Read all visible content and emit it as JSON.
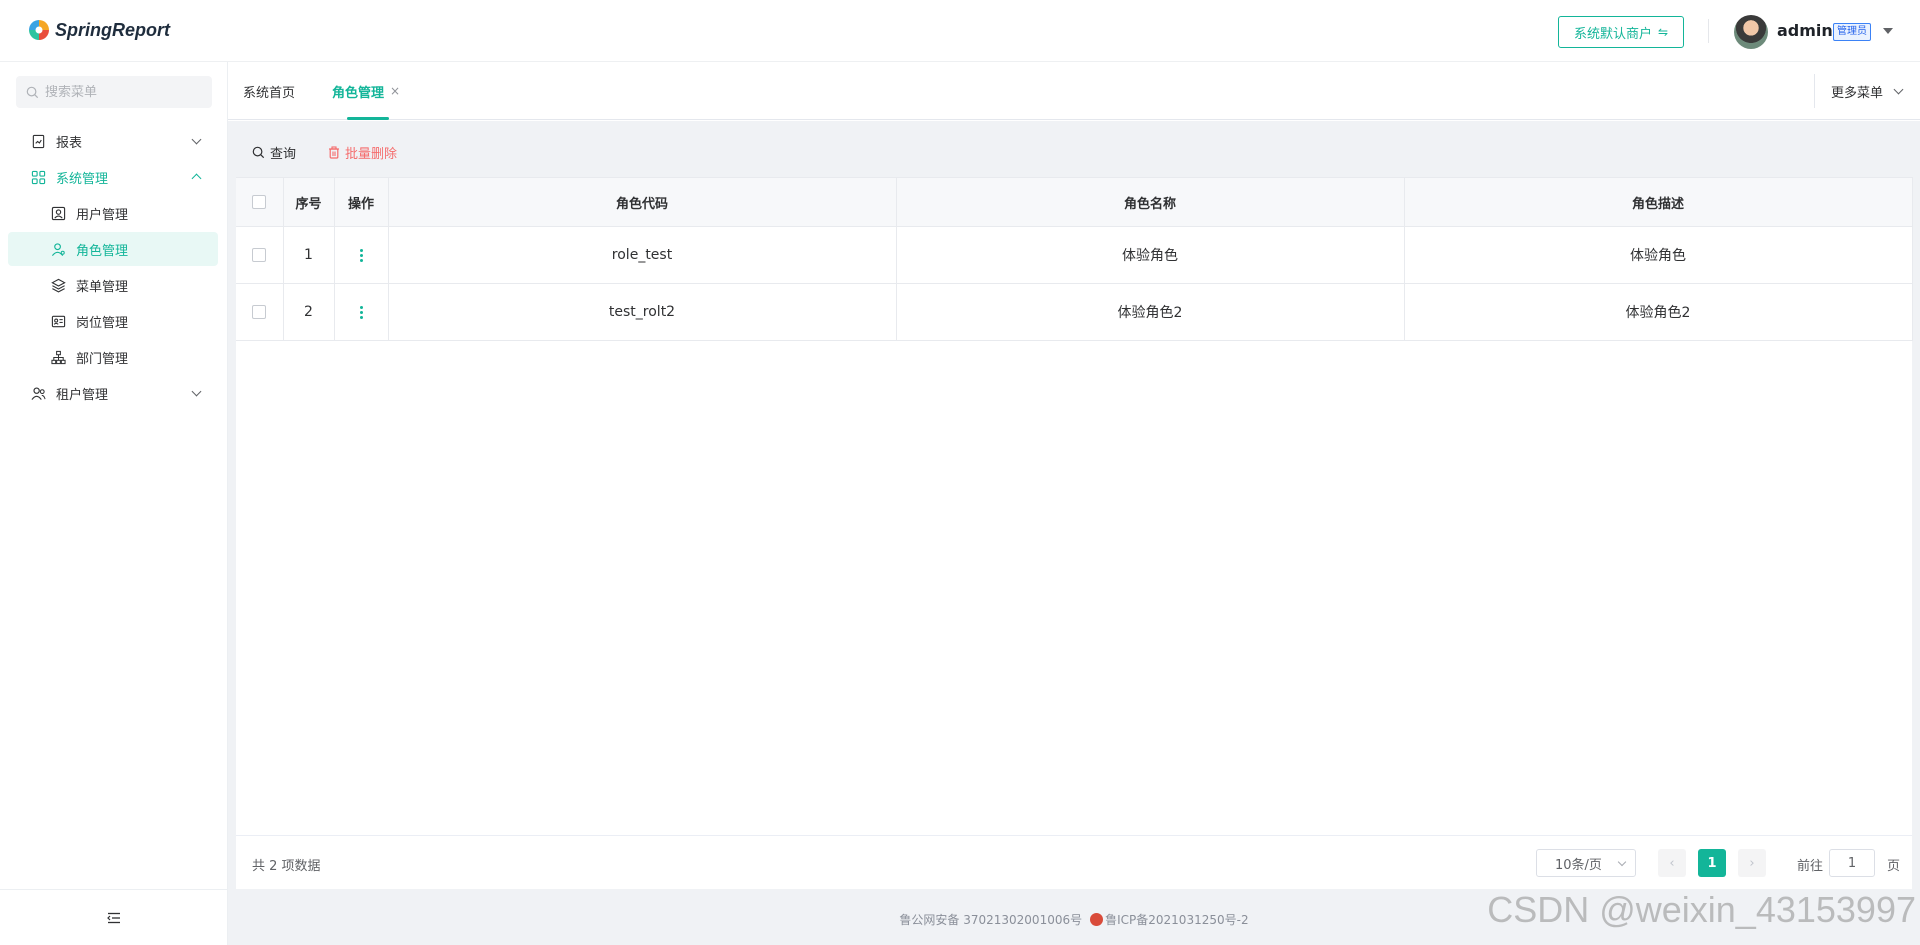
{
  "app": {
    "name": "SpringReport"
  },
  "header": {
    "tenant_button": "系统默认商户",
    "tenant_icon": "swap-icon",
    "user_name": "admin",
    "role_badge": "管理员"
  },
  "sidebar": {
    "search_placeholder": "搜索菜单",
    "items": [
      {
        "label": "报表",
        "icon": "report-icon"
      },
      {
        "label": "系统管理",
        "icon": "grid-icon"
      },
      {
        "label": "用户管理",
        "icon": "user-card-icon"
      },
      {
        "label": "角色管理",
        "icon": "user-role-icon"
      },
      {
        "label": "菜单管理",
        "icon": "layers-icon"
      },
      {
        "label": "岗位管理",
        "icon": "id-card-icon"
      },
      {
        "label": "部门管理",
        "icon": "org-tree-icon"
      },
      {
        "label": "租户管理",
        "icon": "tenant-icon"
      }
    ],
    "collapse_icon": "menu-fold-icon"
  },
  "tabs": {
    "items": [
      {
        "label": "系统首页"
      },
      {
        "label": "角色管理",
        "close": "×"
      }
    ],
    "more_menu": "更多菜单"
  },
  "toolbar": {
    "query_label": "查询",
    "batch_delete_label": "批量删除"
  },
  "table": {
    "columns": [
      "序号",
      "操作",
      "角色代码",
      "角色名称",
      "角色描述"
    ],
    "rows": [
      {
        "index": "1",
        "code": "role_test",
        "name": "体验角色",
        "desc": "体验角色"
      },
      {
        "index": "2",
        "code": "test_rolt2",
        "name": "体验角色2",
        "desc": "体验角色2"
      }
    ]
  },
  "pagination": {
    "total_text": "共 2 项数据",
    "page_size": "10条/页",
    "current_page": "1",
    "goto_label": "前往",
    "goto_value": "1",
    "goto_suffix": "页"
  },
  "footer": {
    "police_record": "鲁公网安备 37021302001006号",
    "icp_record": "鲁ICP备2021031250号-2"
  },
  "watermark": "CSDN @weixin_43153997",
  "colors": {
    "accent": "#13b599",
    "danger": "#f56c6c"
  }
}
